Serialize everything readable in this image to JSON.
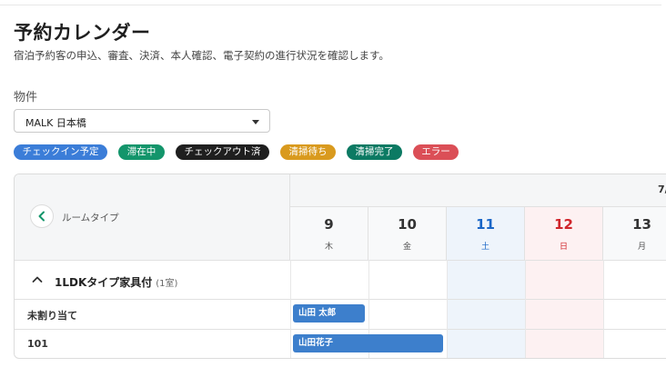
{
  "page": {
    "title": "予約カレンダー",
    "subtitle": "宿泊予約客の申込、審査、決済、本人確認、電子契約の進行状況を確認します。"
  },
  "property": {
    "label": "物件",
    "selected": "MALK 日本橋"
  },
  "legend": [
    {
      "label": "チェックイン予定",
      "color": "#3b7dd8"
    },
    {
      "label": "滞在中",
      "color": "#13956b"
    },
    {
      "label": "チェックアウト済",
      "color": "#1f1f1f"
    },
    {
      "label": "清掃待ち",
      "color": "#d99a1e"
    },
    {
      "label": "清掃完了",
      "color": "#0c7a63"
    },
    {
      "label": "エラー",
      "color": "#db4f57"
    }
  ],
  "calendar": {
    "header_label": "ルームタイプ",
    "month_label": "7/",
    "days": [
      {
        "num": "9",
        "weekday": "木",
        "kind": "weekday"
      },
      {
        "num": "10",
        "weekday": "金",
        "kind": "weekday"
      },
      {
        "num": "11",
        "weekday": "土",
        "kind": "saturday"
      },
      {
        "num": "12",
        "weekday": "日",
        "kind": "sunday"
      },
      {
        "num": "13",
        "weekday": "月",
        "kind": "weekday"
      }
    ],
    "group": {
      "name": "1LDKタイプ家具付",
      "count": "(1室)"
    },
    "rows": [
      {
        "label": "未割り当て",
        "booking": "山田 太郎"
      },
      {
        "label": "101",
        "booking": "山田花子"
      }
    ]
  },
  "colors": {
    "saturday_text": "#1a66c7",
    "sunday_text": "#d0252b",
    "saturday_bg": "#eef4fb",
    "sunday_bg": "#fdf1f2",
    "booking": "#3d7fcc"
  }
}
